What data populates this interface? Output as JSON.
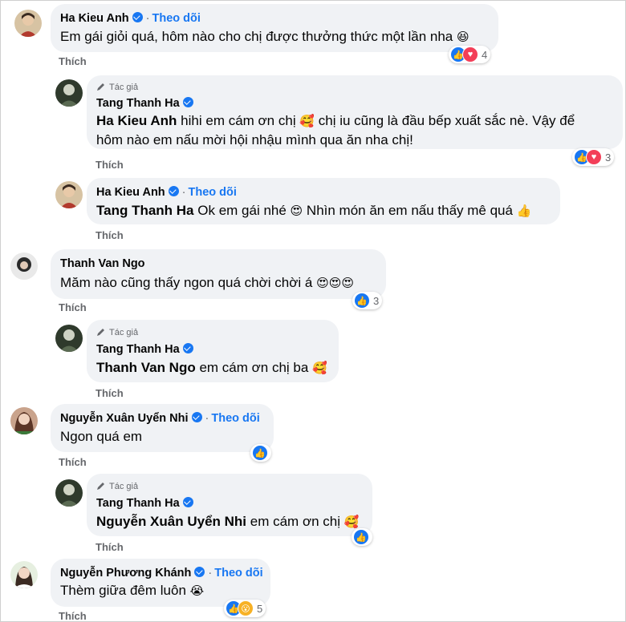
{
  "ui": {
    "follow_label": "Theo dõi",
    "like_label": "Thích",
    "author_label": "Tác giả"
  },
  "comments": [
    {
      "name": "Ha Kieu Anh",
      "text": "Em gái giỏi quá, hôm nào cho chị được thưởng thức một lần nha",
      "emoji": "😆",
      "reactions": [
        "like",
        "heart"
      ],
      "reaction_count": "4"
    },
    {
      "name": "Tang Thanh Ha",
      "mention": "Ha Kieu Anh",
      "text_a": "hihi em cám ơn chị",
      "emoji_a": "🥰",
      "text_b": "chị iu cũng là đầu bếp xuất sắc nè. Vậy để",
      "text_line2": "hôm nào em nấu mời hội nhậu mình qua ăn nha chị!",
      "reactions": [
        "like",
        "heart"
      ],
      "reaction_count": "3"
    },
    {
      "name": "Ha Kieu Anh",
      "mention": "Tang Thanh Ha",
      "text_a": "Ok em gái nhé",
      "emoji_a": "😍",
      "text_b": "Nhìn món ăn em nấu thấy mê quá",
      "emoji_b": "👍"
    },
    {
      "name": "Thanh Van Ngo",
      "text": "Măm nào cũng thấy ngon quá chời chời á",
      "emoji": "😍😍😍",
      "reactions": [
        "like"
      ],
      "reaction_count": "3"
    },
    {
      "name": "Tang Thanh Ha",
      "mention": "Thanh Van Ngo",
      "text_a": "em cám ơn chị ba",
      "emoji_a": "🥰"
    },
    {
      "name": "Nguyễn Xuân Uyển Nhi",
      "text": "Ngon quá em",
      "reactions": [
        "like"
      ]
    },
    {
      "name": "Tang Thanh Ha",
      "mention": "Nguyễn Xuân Uyển Nhi",
      "text_a": "em cám ơn chị",
      "emoji_a": "🥰",
      "reactions": [
        "like"
      ]
    },
    {
      "name": "Nguyễn Phương Khánh",
      "text": "Thèm giữa đêm luôn",
      "emoji": "😭",
      "reactions": [
        "like",
        "wow"
      ],
      "reaction_count": "5"
    }
  ],
  "colors": {
    "accent": "#1877f2",
    "bubble": "#f0f2f5",
    "secondary_text": "#65676b",
    "heart": "#f33e58"
  }
}
